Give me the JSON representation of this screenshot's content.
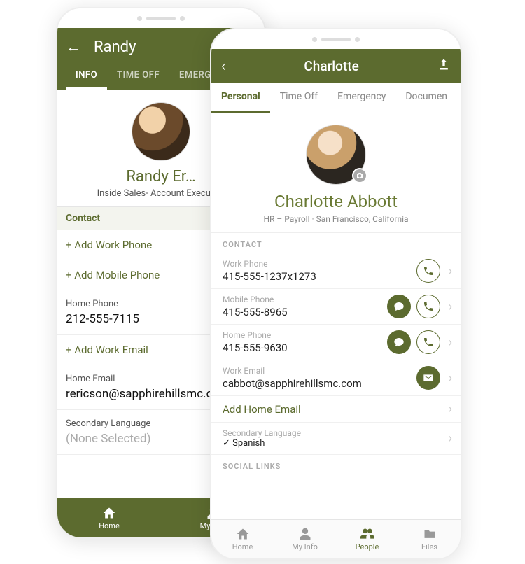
{
  "left": {
    "header": {
      "title": "Randy"
    },
    "tabs": [
      "INFO",
      "TIME OFF",
      "EMERGEN"
    ],
    "active_tab": 0,
    "profile": {
      "name": "Randy Er…",
      "subtitle": "Inside Sales- Account Executive"
    },
    "section_contact": "Contact",
    "rows": {
      "add_work_phone": "+ Add Work Phone",
      "add_mobile_phone": "+ Add Mobile Phone",
      "home_phone_label": "Home Phone",
      "home_phone_value": "212-555-7115",
      "add_work_email": "+ Add Work Email",
      "home_email_label": "Home Email",
      "home_email_value": "rericson@sapphirehillsmc.com",
      "secondary_lang_label": "Secondary Language",
      "secondary_lang_value": "(None Selected)"
    },
    "bottom_nav": [
      "Home",
      "My Info"
    ]
  },
  "right": {
    "header": {
      "title": "Charlotte"
    },
    "tabs": [
      "Personal",
      "Time Off",
      "Emergency",
      "Documen"
    ],
    "active_tab": 0,
    "profile": {
      "name": "Charlotte Abbott",
      "subtitle": "HR – Payroll · San Francisco, California"
    },
    "section_contact": "CONTACT",
    "rows": {
      "work_phone_label": "Work Phone",
      "work_phone_value": "415-555-1237x1273",
      "mobile_phone_label": "Mobile Phone",
      "mobile_phone_value": "415-555-8965",
      "home_phone_label": "Home Phone",
      "home_phone_value": "415-555-9630",
      "work_email_label": "Work Email",
      "work_email_value": "cabbot@sapphirehillsmc.com",
      "add_home_email": "Add Home Email",
      "secondary_lang_label": "Secondary Language",
      "secondary_lang_value": "Spanish"
    },
    "section_social": "SOCIAL LINKS",
    "bottom_nav": [
      "Home",
      "My Info",
      "People",
      "Files"
    ],
    "bottom_nav_active": 2
  }
}
